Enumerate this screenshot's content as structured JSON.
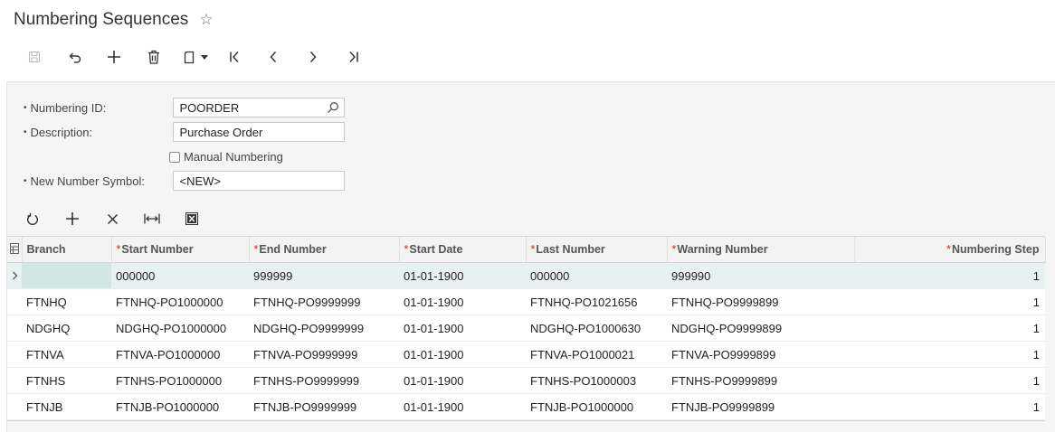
{
  "page": {
    "title": "Numbering Sequences"
  },
  "form": {
    "numbering_id": {
      "label": "Numbering ID:",
      "value": "POORDER"
    },
    "description": {
      "label": "Description:",
      "value": "Purchase Order"
    },
    "manual_numbering": {
      "label": "Manual Numbering",
      "checked": false
    },
    "new_number_symbol": {
      "label": "New Number Symbol:",
      "value": "<NEW>"
    }
  },
  "grid": {
    "columns": {
      "branch": "Branch",
      "start_number": "Start Number",
      "end_number": "End Number",
      "start_date": "Start Date",
      "last_number": "Last Number",
      "warning_number": "Warning Number",
      "numbering_step": "Numbering Step"
    },
    "rows": [
      {
        "branch": "",
        "start_number": "000000",
        "end_number": "999999",
        "start_date": "01-01-1900",
        "last_number": "000000",
        "warning_number": "999990",
        "numbering_step": "1"
      },
      {
        "branch": "FTNHQ",
        "start_number": "FTNHQ-PO1000000",
        "end_number": "FTNHQ-PO9999999",
        "start_date": "01-01-1900",
        "last_number": "FTNHQ-PO1021656",
        "warning_number": "FTNHQ-PO9999899",
        "numbering_step": "1"
      },
      {
        "branch": "NDGHQ",
        "start_number": "NDGHQ-PO1000000",
        "end_number": "NDGHQ-PO9999999",
        "start_date": "01-01-1900",
        "last_number": "NDGHQ-PO1000630",
        "warning_number": "NDGHQ-PO9999899",
        "numbering_step": "1"
      },
      {
        "branch": "FTNVA",
        "start_number": "FTNVA-PO1000000",
        "end_number": "FTNVA-PO9999999",
        "start_date": "01-01-1900",
        "last_number": "FTNVA-PO1000021",
        "warning_number": "FTNVA-PO9999899",
        "numbering_step": "1"
      },
      {
        "branch": "FTNHS",
        "start_number": "FTNHS-PO1000000",
        "end_number": "FTNHS-PO9999999",
        "start_date": "01-01-1900",
        "last_number": "FTNHS-PO1000003",
        "warning_number": "FTNHS-PO9999899",
        "numbering_step": "1"
      },
      {
        "branch": "FTNJB",
        "start_number": "FTNJB-PO1000000",
        "end_number": "FTNJB-PO9999999",
        "start_date": "01-01-1900",
        "last_number": "FTNJB-PO1000000",
        "warning_number": "FTNJB-PO9999899",
        "numbering_step": "1"
      }
    ]
  },
  "icons": {
    "favorite": "star-outline-icon",
    "toolbar": [
      "save-icon",
      "undo-icon",
      "add-icon",
      "delete-icon",
      "copy-paste-icon",
      "first-record-icon",
      "previous-record-icon",
      "next-record-icon",
      "last-record-icon"
    ],
    "grid_toolbar": [
      "refresh-icon",
      "add-row-icon",
      "delete-row-icon",
      "fit-columns-icon",
      "export-excel-icon"
    ]
  },
  "colors": {
    "required_mark": "#e02020",
    "active_row": "#e8f1f1",
    "panel_bg": "#f5f5f5"
  }
}
